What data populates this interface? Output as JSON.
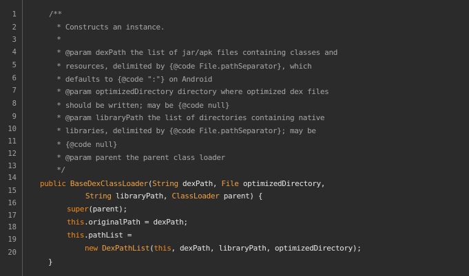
{
  "editor": {
    "line_numbers": [
      "1",
      "2",
      "3",
      "4",
      "5",
      "6",
      "7",
      "8",
      "9",
      "10",
      "11",
      "12",
      "13",
      "14",
      "15",
      "16",
      "17",
      "18",
      "19",
      "20"
    ],
    "code_lines": [
      [
        {
          "t": "/**",
          "c": "comment"
        }
      ],
      [
        {
          "t": " * Constructs an instance.",
          "c": "comment"
        }
      ],
      [
        {
          "t": " *",
          "c": "comment"
        }
      ],
      [
        {
          "t": " * @param dexPath the list of jar/apk files containing classes and",
          "c": "comment"
        }
      ],
      [
        {
          "t": " * resources, delimited by {@code File.pathSeparator}, which",
          "c": "comment"
        }
      ],
      [
        {
          "t": " * defaults to {@code \":\"} on Android",
          "c": "comment"
        }
      ],
      [
        {
          "t": " * @param optimizedDirectory directory where optimized dex files",
          "c": "comment"
        }
      ],
      [
        {
          "t": " * should be written; may be {@code null}",
          "c": "comment"
        }
      ],
      [
        {
          "t": " * @param libraryPath the list of directories containing native",
          "c": "comment"
        }
      ],
      [
        {
          "t": " * libraries, delimited by {@code File.pathSeparator}; may be",
          "c": "comment"
        }
      ],
      [
        {
          "t": " * {@code null}",
          "c": "comment"
        }
      ],
      [
        {
          "t": " * @param parent the parent class loader",
          "c": "comment"
        }
      ],
      [
        {
          "t": " */",
          "c": "comment"
        }
      ],
      [
        {
          "t": "public ",
          "c": "keyword"
        },
        {
          "t": "BaseDexClassLoader",
          "c": "type"
        },
        {
          "t": "(",
          "c": "plain"
        },
        {
          "t": "String",
          "c": "type"
        },
        {
          "t": " dexPath, ",
          "c": "plain"
        },
        {
          "t": "File",
          "c": "type"
        },
        {
          "t": " optimizedDirectory,",
          "c": "plain"
        }
      ],
      [
        {
          "t": "String",
          "c": "type"
        },
        {
          "t": " libraryPath, ",
          "c": "plain"
        },
        {
          "t": "ClassLoader",
          "c": "type"
        },
        {
          "t": " parent) {",
          "c": "plain"
        }
      ],
      [
        {
          "t": "super",
          "c": "keyword"
        },
        {
          "t": "(parent);",
          "c": "plain"
        }
      ],
      [
        {
          "t": "this",
          "c": "keyword"
        },
        {
          "t": ".originalPath = dexPath;",
          "c": "plain"
        }
      ],
      [
        {
          "t": "this",
          "c": "keyword"
        },
        {
          "t": ".pathList =",
          "c": "plain"
        }
      ],
      [
        {
          "t": "new ",
          "c": "keyword"
        },
        {
          "t": "DexPathList",
          "c": "type"
        },
        {
          "t": "(",
          "c": "plain"
        },
        {
          "t": "this",
          "c": "keyword"
        },
        {
          "t": ", dexPath, libraryPath, optimizedDirectory);",
          "c": "plain"
        }
      ],
      [
        {
          "t": "}",
          "c": "plain"
        }
      ]
    ]
  }
}
